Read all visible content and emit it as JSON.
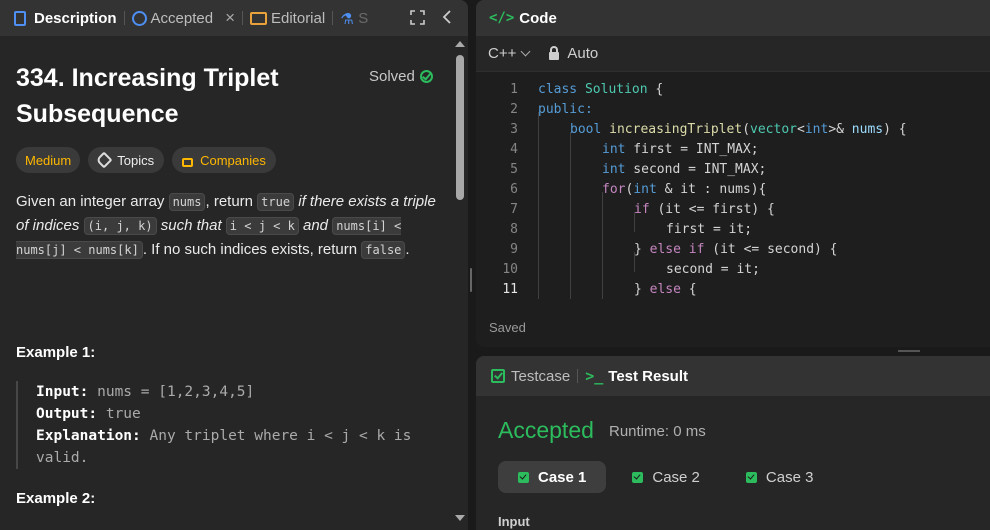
{
  "left_tabs": {
    "description": "Description",
    "accepted": "Accepted",
    "editorial": "Editorial",
    "solutions": "S"
  },
  "problem": {
    "title": "334. Increasing Triplet Subsequence",
    "solved_label": "Solved",
    "difficulty": "Medium",
    "topics_label": "Topics",
    "companies_label": "Companies"
  },
  "statement": {
    "p1": "Given an integer array ",
    "c_nums": "nums",
    "p2": ", return ",
    "c_true": "true",
    "p3": " if there exists a triple of indices ",
    "c_ijk": "(i, j, k)",
    "p4": " such that ",
    "c_ilt": "i < j < k",
    "p5": " and ",
    "c_cmp": "nums[i] < nums[j] < nums[k]",
    "p6": ". If no such indices exists, return ",
    "c_false": "false",
    "p7": "."
  },
  "example1": {
    "title": "Example 1:",
    "input_key": "Input:",
    "input_val": " nums = [1,2,3,4,5]",
    "output_key": "Output:",
    "output_val": " true",
    "expl_key": "Explanation:",
    "expl_val": " Any triplet where i < j < k is valid."
  },
  "example2": {
    "title": "Example 2:"
  },
  "code_panel": {
    "title": "Code",
    "icon": "</>",
    "language": "C++",
    "mode": "Auto",
    "status": "Saved",
    "lines": [
      {
        "n": "1"
      },
      {
        "n": "2"
      },
      {
        "n": "3"
      },
      {
        "n": "4"
      },
      {
        "n": "5"
      },
      {
        "n": "6"
      },
      {
        "n": "7"
      },
      {
        "n": "8"
      },
      {
        "n": "9"
      },
      {
        "n": "10"
      },
      {
        "n": "11"
      }
    ],
    "tokens": {
      "class": "class",
      "Solution": "Solution",
      "brace_open": " {",
      "public": "public:",
      "bool": "bool",
      "fn": "increasingTriplet",
      "open": "(",
      "vector": "vector",
      "lt": "<",
      "int": "int",
      "gt_amp": ">& ",
      "nums": "nums",
      "close_brace": ") {",
      "l4_int": "int",
      "l4_rest": " first = INT_MAX;",
      "l5_int": "int",
      "l5_rest": " second = INT_MAX;",
      "l6_for": "for",
      "l6_open": "(",
      "l6_int": "int",
      "l6_rest": " & it : nums){",
      "l7_if": "if",
      "l7_rest": " (it <= first) {",
      "l8_rest": "first = it;",
      "l9_close": "} ",
      "l9_else": "else",
      "l9_sp": " ",
      "l9_if": "if",
      "l9_rest": " (it <= second) {",
      "l10_rest": "second = it;",
      "l11_close": "} ",
      "l11_else": "else",
      "l11_rest": " {"
    }
  },
  "test_panel": {
    "testcase_label": "Testcase",
    "result_icon": ">_",
    "result_label": "Test Result",
    "status": "Accepted",
    "runtime": "Runtime: 0 ms",
    "cases": [
      "Case 1",
      "Case 2",
      "Case 3"
    ],
    "input_label": "Input"
  },
  "colors": {
    "accent_green": "#2cbb5d",
    "medium_yellow": "#ffb800",
    "tab_blue": "#4e8ff3"
  }
}
